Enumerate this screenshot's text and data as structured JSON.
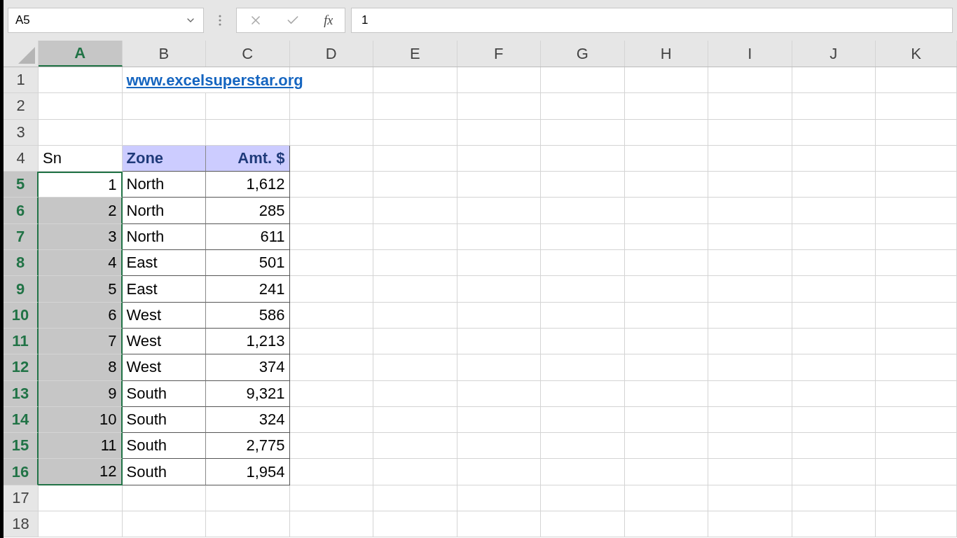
{
  "formula_bar": {
    "name_box": "A5",
    "function_label": "fx",
    "value": "1"
  },
  "columns": [
    {
      "label": "A",
      "selected": true
    },
    {
      "label": "B",
      "selected": false
    },
    {
      "label": "C",
      "selected": false
    },
    {
      "label": "D",
      "selected": false
    },
    {
      "label": "E",
      "selected": false
    },
    {
      "label": "F",
      "selected": false
    },
    {
      "label": "G",
      "selected": false
    },
    {
      "label": "H",
      "selected": false
    },
    {
      "label": "I",
      "selected": false
    },
    {
      "label": "J",
      "selected": false
    },
    {
      "label": "K",
      "selected": false
    }
  ],
  "rows": [
    {
      "number": "1",
      "kind": "link",
      "selected": false,
      "text": "www.excelsuperstar.org"
    },
    {
      "number": "2",
      "kind": "blank",
      "selected": false
    },
    {
      "number": "3",
      "kind": "blank",
      "selected": false
    },
    {
      "number": "4",
      "kind": "header",
      "selected": false,
      "sn": "Sn",
      "zone": "Zone",
      "amount": "Amt. $"
    },
    {
      "number": "5",
      "kind": "data",
      "selected": true,
      "active": true,
      "sn": "1",
      "zone": "North",
      "amount": "1,612"
    },
    {
      "number": "6",
      "kind": "data",
      "selected": true,
      "active": false,
      "sn": "2",
      "zone": "North",
      "amount": "285"
    },
    {
      "number": "7",
      "kind": "data",
      "selected": true,
      "active": false,
      "sn": "3",
      "zone": "North",
      "amount": "611"
    },
    {
      "number": "8",
      "kind": "data",
      "selected": true,
      "active": false,
      "sn": "4",
      "zone": "East",
      "amount": "501"
    },
    {
      "number": "9",
      "kind": "data",
      "selected": true,
      "active": false,
      "sn": "5",
      "zone": "East",
      "amount": "241"
    },
    {
      "number": "10",
      "kind": "data",
      "selected": true,
      "active": false,
      "sn": "6",
      "zone": "West",
      "amount": "586"
    },
    {
      "number": "11",
      "kind": "data",
      "selected": true,
      "active": false,
      "sn": "7",
      "zone": "West",
      "amount": "1,213"
    },
    {
      "number": "12",
      "kind": "data",
      "selected": true,
      "active": false,
      "sn": "8",
      "zone": "West",
      "amount": "374"
    },
    {
      "number": "13",
      "kind": "data",
      "selected": true,
      "active": false,
      "sn": "9",
      "zone": "South",
      "amount": "9,321"
    },
    {
      "number": "14",
      "kind": "data",
      "selected": true,
      "active": false,
      "sn": "10",
      "zone": "South",
      "amount": "324"
    },
    {
      "number": "15",
      "kind": "data",
      "selected": true,
      "active": false,
      "sn": "11",
      "zone": "South",
      "amount": "2,775"
    },
    {
      "number": "16",
      "kind": "data",
      "selected": true,
      "active": false,
      "sn": "12",
      "zone": "South",
      "amount": "1,954"
    },
    {
      "number": "17",
      "kind": "blank",
      "selected": false
    },
    {
      "number": "18",
      "kind": "blank",
      "selected": false
    }
  ]
}
